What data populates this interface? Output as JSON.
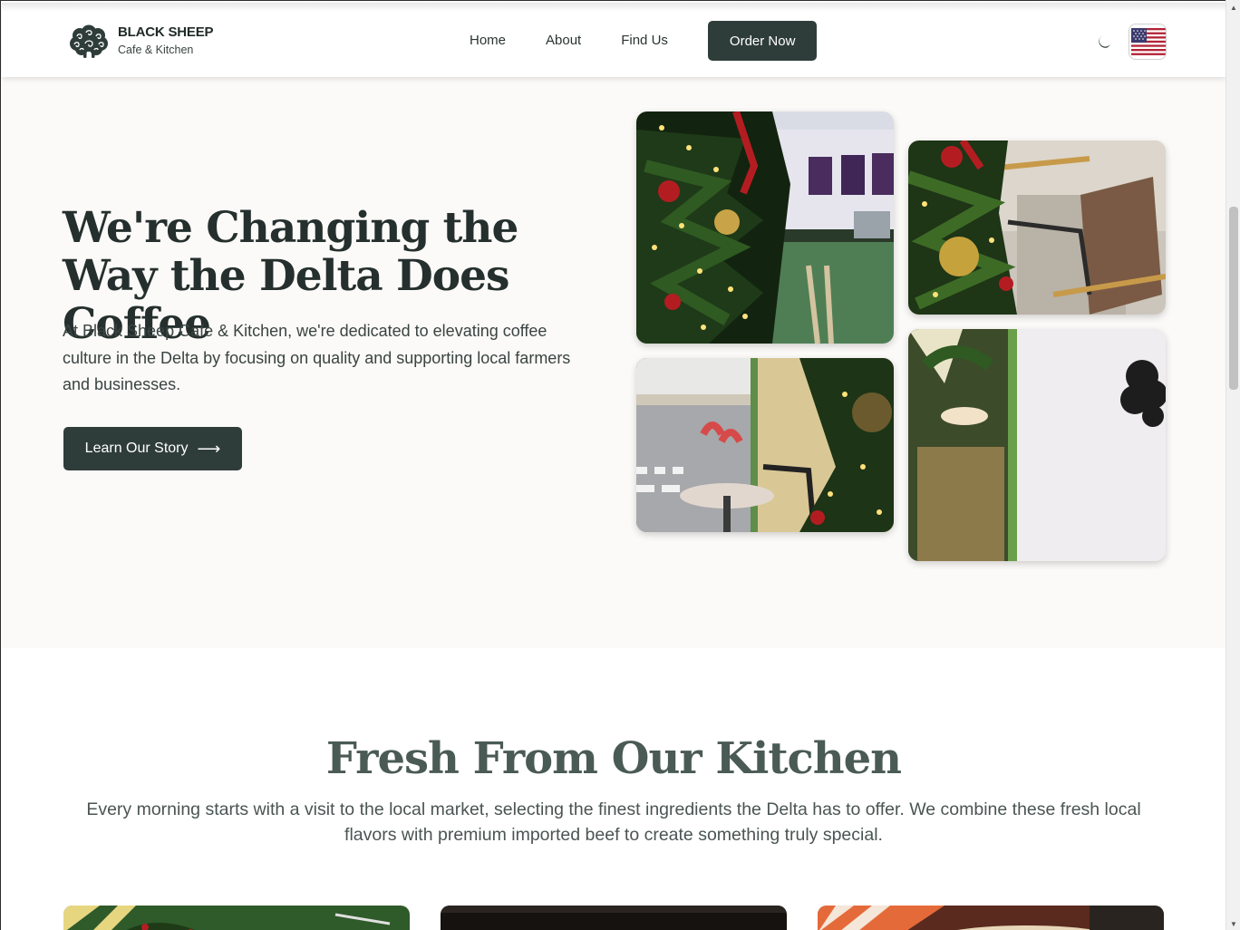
{
  "brand": {
    "name": "BLACK SHEEP",
    "tagline": "Cafe & Kitchen"
  },
  "nav": {
    "items": [
      {
        "label": "Home"
      },
      {
        "label": "About"
      },
      {
        "label": "Find Us"
      }
    ],
    "cta_label": "Order Now",
    "theme_icon": "moon-icon",
    "language_icon": "us-flag-icon"
  },
  "hero": {
    "title": "We're Changing the Way the Delta Does Coffee",
    "description": "At Black Sheep Cafe & Kitchen, we're dedicated to elevating coffee culture in the Delta by focusing on quality and supporting local farmers and businesses.",
    "button_label": "Learn Our Story",
    "button_icon": "arrow-right-icon"
  },
  "kitchen": {
    "title": "Fresh From Our Kitchen",
    "description": "Every morning starts with a visit to the local market, selecting the finest ingredients the Delta has to offer. We combine these fresh local flavors with premium imported beef to create something truly special."
  },
  "colors": {
    "primary": "#2f3d3a",
    "hero_background": "#fbfaf8",
    "heading": "#25302e",
    "section_heading": "#4a5a55"
  }
}
